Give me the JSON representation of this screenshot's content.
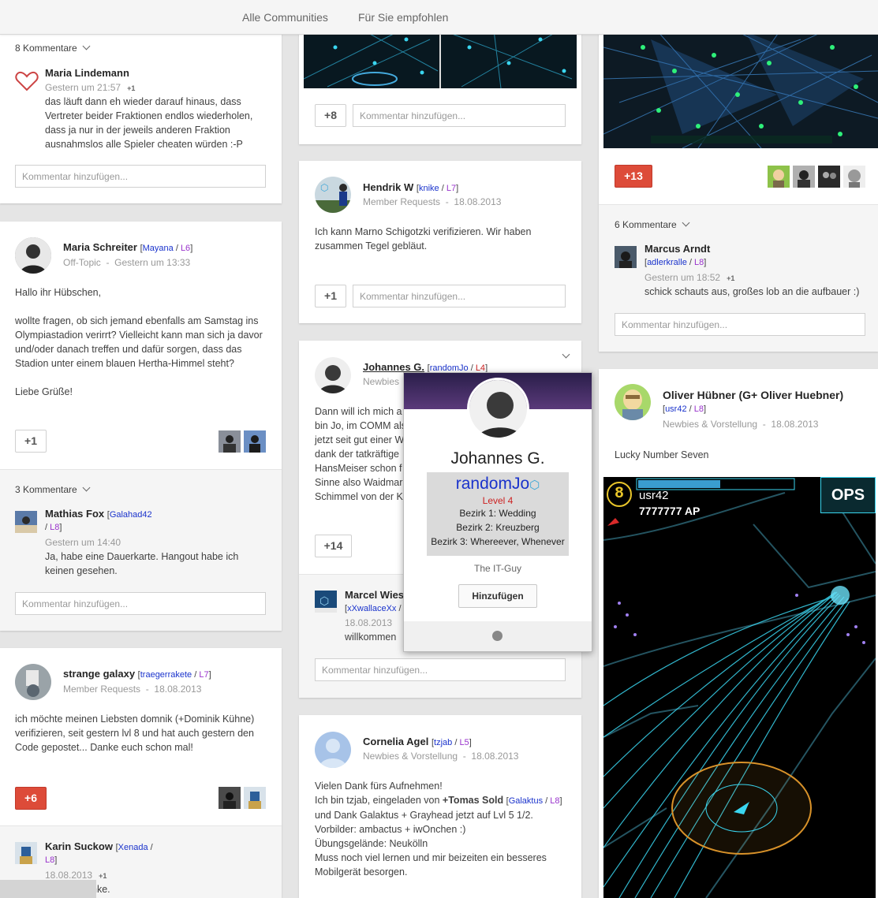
{
  "nav": {
    "tab_all": "Alle Communities",
    "tab_recommended": "Für Sie empfohlen"
  },
  "col1": {
    "post1": {
      "comments_count": "8 Kommentare",
      "comment": {
        "author": "Maria Lindemann",
        "time": "Gestern um 21:57",
        "plus": "+1",
        "text": "das läuft dann eh wieder darauf hinaus, dass Vertreter beider Fraktionen endlos wiederholen, dass ja nur in der jeweils anderen Fraktion ausnahmslos alle Spieler cheaten würden :-P"
      },
      "add_comment": "Kommentar hinzufügen..."
    },
    "post2": {
      "author": "Maria Schreiter",
      "nick": "Mayana",
      "level": "L6",
      "category": "Off-Topic",
      "time": "Gestern um 13:33",
      "greeting": "Hallo ihr Hübschen,",
      "body": "wollte fragen, ob sich jemand ebenfalls am Samstag ins Olympiastadion verirrt? Vielleicht kann man sich ja davor und/oder danach treffen und dafür sorgen, dass das Stadion unter einem blauen Hertha-Himmel steht?",
      "signoff": "Liebe Grüße!",
      "plus": "+1",
      "comments_count": "3 Kommentare",
      "comment": {
        "author": "Mathias Fox",
        "nick": "Galahad42",
        "level": "L8",
        "time": "Gestern um 14:40",
        "text": "Ja, habe eine Dauerkarte. Hangout habe ich keinen gesehen."
      },
      "add_comment": "Kommentar hinzufügen..."
    },
    "post3": {
      "author": "strange galaxy",
      "nick": "traegerrakete",
      "level": "L7",
      "category": "Member Requests",
      "time": "18.08.2013",
      "body": "ich möchte meinen Liebsten domnik (+Dominik Kühne) verifizieren, seit gestern lvl 8 und hat auch gestern den Code gepostet... Danke euch schon mal!",
      "plus": "+6",
      "comment": {
        "author": "Karin Suckow",
        "nick": "Xenada",
        "level": "L8",
        "time": "18.08.2013",
        "plus": "+1",
        "text": "nke."
      }
    }
  },
  "col2": {
    "post1": {
      "plus": "+8",
      "add_comment": "Kommentar hinzufügen..."
    },
    "post2": {
      "author": "Hendrik W",
      "nick": "knike",
      "level": "L7",
      "category": "Member Requests",
      "time": "18.08.2013",
      "body": "Ich kann Marno Schigotzki verifizieren. Wir haben zusammen Tegel gebläut.",
      "plus": "+1",
      "add_comment": "Kommentar hinzufügen..."
    },
    "post3": {
      "author": "Johannes G.",
      "nick": "randomJo",
      "level": "L4",
      "category": "Newbies",
      "lines": [
        "Dann will ich mich a",
        "bin Jo, im COMM als",
        "jetzt seit gut einer W",
        "dank der tatkräftige",
        "HansMeiser schon f",
        "Sinne also Waidmar",
        "Schimmel von der K"
      ],
      "plus": "+14",
      "comment": {
        "author": "Marcel Wiese",
        "nick": "xXwallaceXx",
        "time": "18.08.2013",
        "text": "willkommen"
      },
      "add_comment": "Kommentar hinzufügen..."
    },
    "post4": {
      "author": "Cornelia Agel",
      "nick": "tzjab",
      "level": "L5",
      "category": "Newbies & Vorstellung",
      "time": "18.08.2013",
      "line1": "Vielen Dank fürs Aufnehmen!",
      "line2_a": "Ich bin tzjab, eingeladen von ",
      "line2_b": "+Tomas Sold",
      "line2_nick": "Galaktus",
      "line2_level": "L8",
      "line3": "und Dank Galaktus + Grayhead jetzt auf Lvl 5 1/2.",
      "line4": "Vorbilder: ambactus + iwOnchen :)",
      "line5": "Übungsgelände: Neukölln",
      "line6": "Muss noch viel lernen und mir beizeiten ein besseres",
      "line7": "Mobilgerät besorgen."
    }
  },
  "col3": {
    "post1": {
      "plus": "+13",
      "comments_count": "6 Kommentare",
      "comment": {
        "author": "Marcus Arndt",
        "nick": "adlerkralle",
        "level": "L8",
        "time": "Gestern um 18:52",
        "plus": "+1",
        "text": "schick schauts aus, großes lob an die aufbauer :)"
      },
      "add_comment": "Kommentar hinzufügen..."
    },
    "post2": {
      "author": "Oliver Hübner (G+ Oliver Huebner)",
      "nick": "usr42",
      "level": "L8",
      "category": "Newbies & Vorstellung",
      "time": "18.08.2013",
      "body": "Lucky Number Seven",
      "game_level": "8",
      "game_user": "usr42",
      "game_ap": "7777777 AP",
      "game_ops": "OPS"
    }
  },
  "popup": {
    "name": "Johannes G.",
    "nick": "randomJo",
    "level": "Level 4",
    "district1": "Bezirk 1: Wedding",
    "district2": "Bezirk 2: Kreuzberg",
    "district3": "Bezirk 3: Whereever, Whenever",
    "tagline": "The IT-Guy",
    "button": "Hinzufügen"
  },
  "colors": {
    "red_button": "#dd4b39",
    "nick_blue": "#1a33cc",
    "level_purple": "#9933cc",
    "ingress_cyan": "#3ad6f0"
  }
}
